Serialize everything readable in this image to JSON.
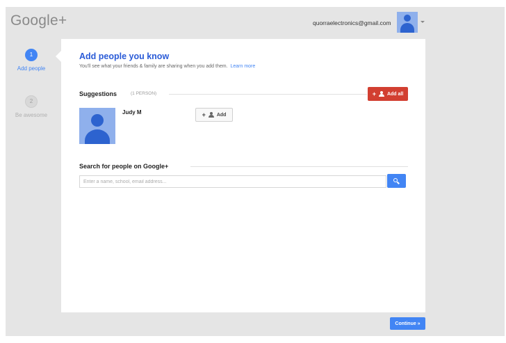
{
  "header": {
    "logo_text": "Google+",
    "account_email": "quorraelectronics@gmail.com"
  },
  "steps": [
    {
      "number": "1",
      "label": "Add people"
    },
    {
      "number": "2",
      "label": "Be awesome"
    }
  ],
  "main": {
    "title": "Add people you know",
    "subtitle": "You'll see what your friends & family are sharing when you add them.",
    "learn_more": "Learn more",
    "suggestions": {
      "title": "Suggestions",
      "count": "(1 PERSON)",
      "add_all_label": "Add all",
      "people": [
        {
          "name": "Judy M",
          "add_label": "Add"
        }
      ]
    },
    "search": {
      "title": "Search for people on Google+",
      "placeholder": "Enter a name, school, email address..."
    }
  },
  "footer": {
    "continue_label": "Continue »"
  },
  "colors": {
    "accent_blue": "#4285f4",
    "title_blue": "#2a5bd7",
    "add_all_red": "#d23f31",
    "background": "#e5e5e5"
  },
  "icons": [
    "person-avatar-icon",
    "dropdown-caret-icon",
    "add-person-icon",
    "search-icon"
  ]
}
